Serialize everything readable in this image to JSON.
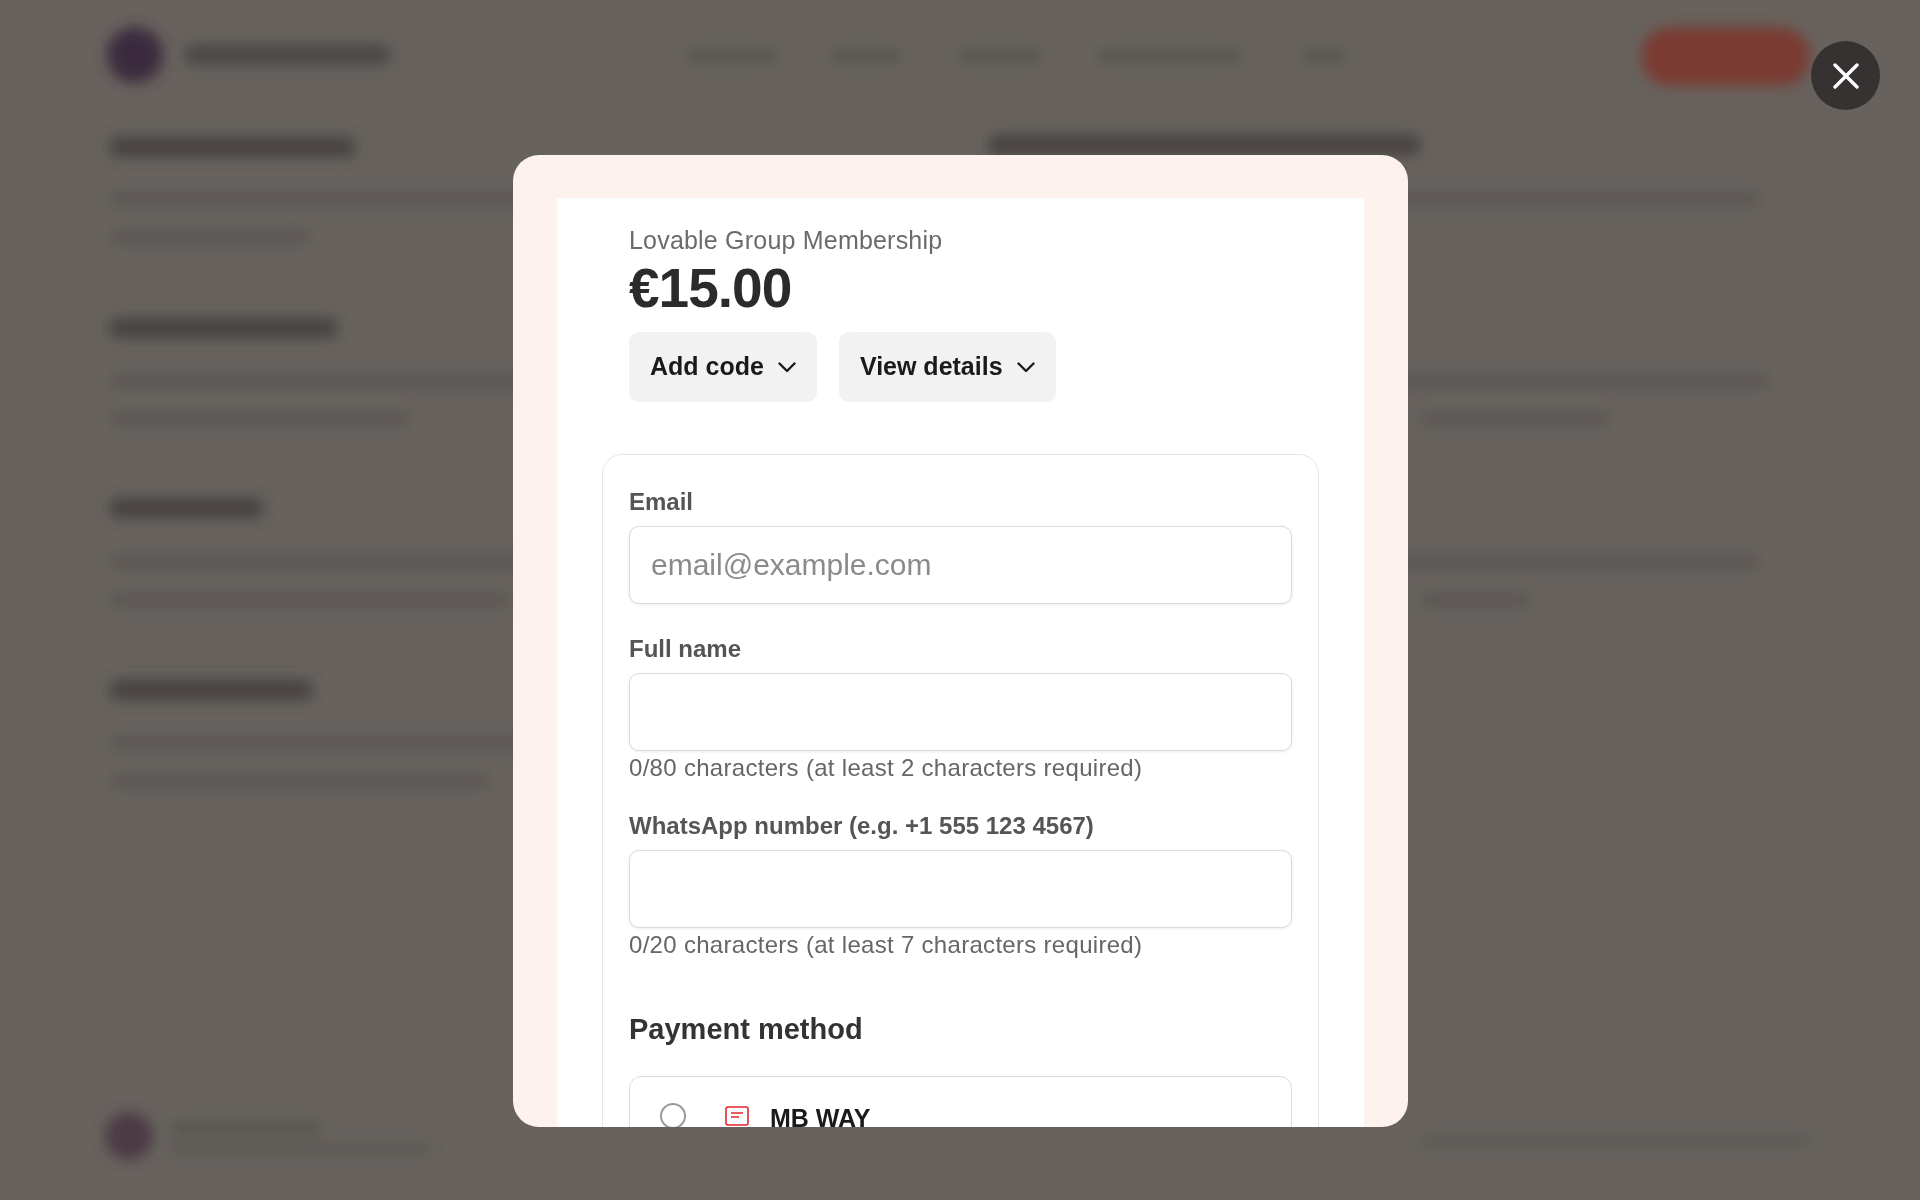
{
  "checkout_modal": {
    "product_name": "Lovable Group Membership",
    "price": "€15.00",
    "actions": [
      {
        "label": "Add code"
      },
      {
        "label": "View details"
      }
    ],
    "form": {
      "fields": [
        {
          "label": "Email",
          "placeholder": "email@example.com"
        },
        {
          "label": "Full name",
          "helper": "0/80 characters (at least 2 characters required)"
        },
        {
          "label": "WhatsApp number (e.g. +1 555 123 4567)",
          "helper": "0/20 characters (at least 7 characters required)"
        }
      ],
      "payment_method": {
        "title": "Payment method",
        "options": [
          {
            "label": "MB WAY",
            "selected": false
          }
        ]
      }
    }
  }
}
